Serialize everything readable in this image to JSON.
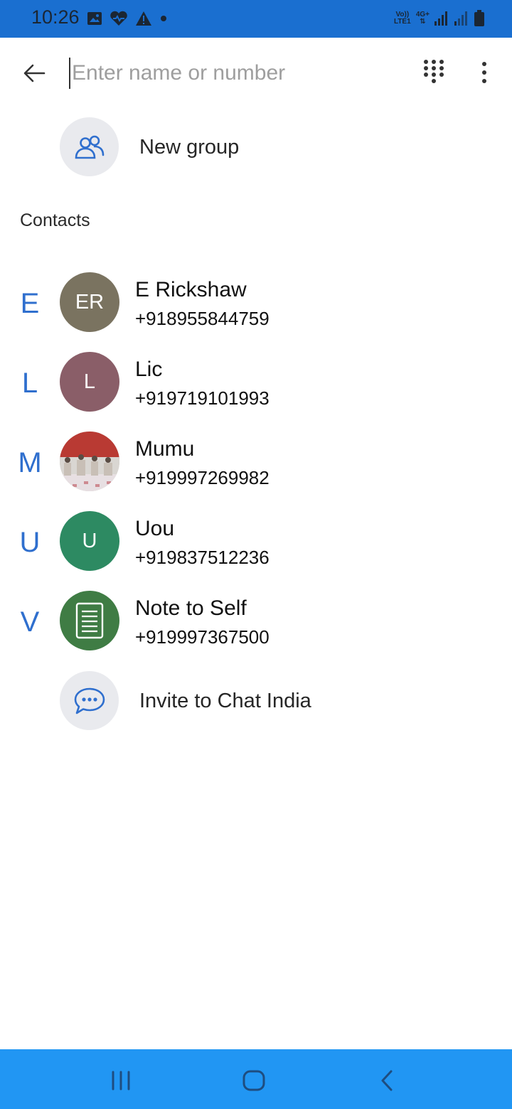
{
  "status_bar": {
    "time": "10:26",
    "left_icons": [
      "image-icon",
      "heart-icon",
      "alert-icon",
      "dot-icon"
    ],
    "network_top": "Vo)) LTE1",
    "network_type": "4G+",
    "right_icons": [
      "signal-icon",
      "signal-icon",
      "battery-icon"
    ]
  },
  "search": {
    "placeholder": "Enter name or number",
    "value": ""
  },
  "new_group": {
    "label": "New group"
  },
  "contacts_section": {
    "title": "Contacts"
  },
  "contacts": [
    {
      "index": "E",
      "initials": "ER",
      "name": "E Rickshaw",
      "number": "+918955844759",
      "color": "#7a7360"
    },
    {
      "index": "L",
      "initials": "L",
      "name": "Lic",
      "number": "+919719101993",
      "color": "#8a5e68"
    },
    {
      "index": "M",
      "initials": "",
      "name": "Mumu",
      "number": "+919997269982",
      "color": "#b93a33"
    },
    {
      "index": "U",
      "initials": "U",
      "name": "Uou",
      "number": "+919837512236",
      "color": "#2d8a62"
    },
    {
      "index": "V",
      "initials": "",
      "name": "Note to Self",
      "number": "+919997367500",
      "color": "#3f7c44"
    }
  ],
  "invite": {
    "label": "Invite to Chat India"
  },
  "colors": {
    "status_bar": "#1a6fd0",
    "nav_bar": "#2196f3",
    "accent": "#2f6fce"
  }
}
